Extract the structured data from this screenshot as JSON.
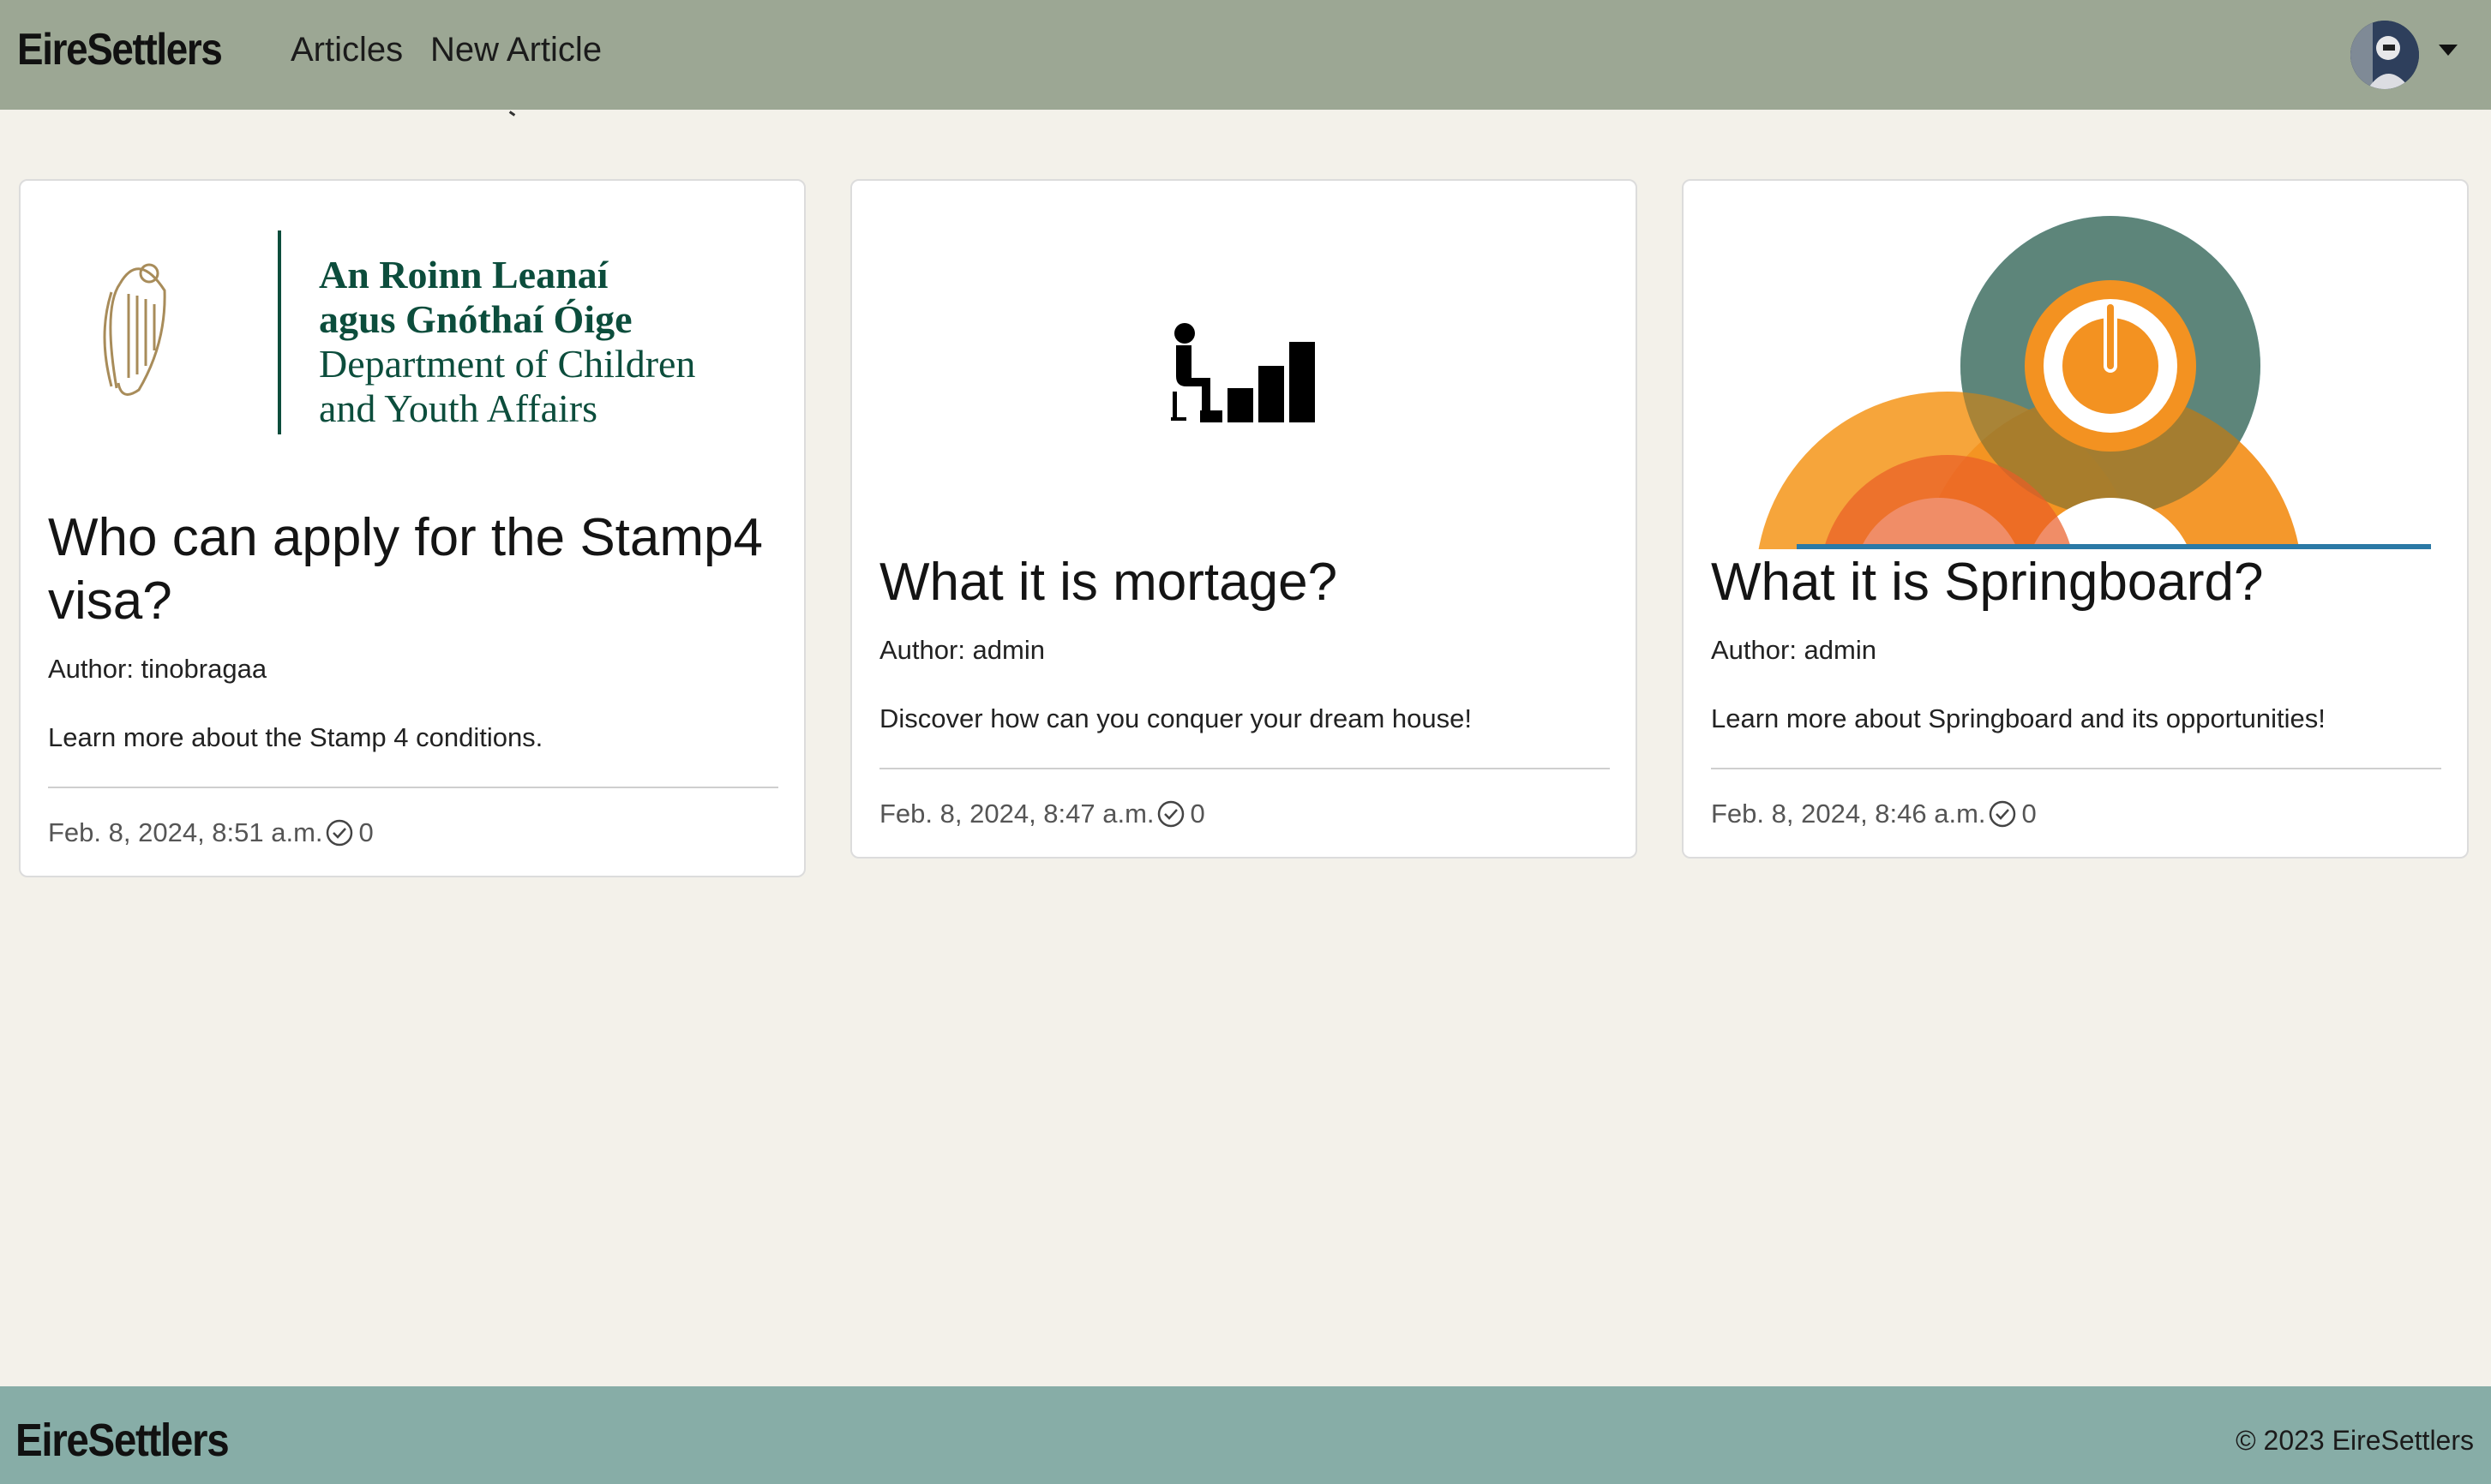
{
  "navbar": {
    "brand": "EireSettlers",
    "links": [
      "Articles",
      "New Article"
    ]
  },
  "articles": [
    {
      "image_alt": "Department of Children and Youth Affairs logo",
      "logo_lines": [
        "An Roinn Leanaí",
        "agus Gnóthaí Óige",
        "Department of Children",
        "and Youth Affairs"
      ],
      "title": "Who can apply for the Stamp4 visa?",
      "author": "Author: tinobragaa",
      "description": "Learn more about the Stamp 4 conditions.",
      "date": "Feb. 8, 2024, 8:51 a.m.",
      "count": "0"
    },
    {
      "image_alt": "mortgage steps icon",
      "title": "What it is mortage?",
      "author": "Author: admin",
      "description": "Discover how can you conquer your dream house!",
      "date": "Feb. 8, 2024, 8:47 a.m.",
      "count": "0"
    },
    {
      "image_alt": "Springboard logo",
      "title": "What it is Springboard?",
      "author": "Author: admin",
      "description": "Learn more about Springboard and its opportunities!",
      "date": "Feb. 8, 2024, 8:46 a.m.",
      "count": "0"
    }
  ],
  "footer": {
    "brand": "EireSettlers",
    "copyright": "© 2023 EireSettlers"
  },
  "icons": {
    "avatar": "user-avatar",
    "caret": "caret-down-icon",
    "meta": "check-circle-icon"
  },
  "colors": {
    "navbar": "#9ca794",
    "footer": "#87ada7",
    "background": "#f3f1ea"
  }
}
